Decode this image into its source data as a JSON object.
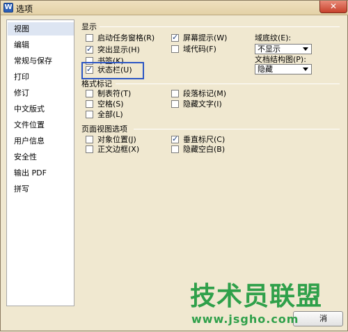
{
  "window": {
    "title": "选项",
    "app_icon": "W",
    "close_label": "✕"
  },
  "sidebar": {
    "items": [
      {
        "label": "视图",
        "selected": true
      },
      {
        "label": "编辑"
      },
      {
        "label": "常规与保存"
      },
      {
        "label": "打印"
      },
      {
        "label": "修订"
      },
      {
        "label": "中文版式"
      },
      {
        "label": "文件位置"
      },
      {
        "label": "用户信息"
      },
      {
        "label": "安全性"
      },
      {
        "label": "输出 PDF"
      },
      {
        "label": "拼写"
      }
    ]
  },
  "display": {
    "heading": "显示",
    "startup_task_pane": {
      "label": "启动任务窗格(R)",
      "checked": false
    },
    "highlight": {
      "label": "突出显示(H)",
      "checked": true
    },
    "bookmarks": {
      "label": "书签(K)",
      "checked": false
    },
    "status_bar": {
      "label": "状态栏(U)",
      "checked": true
    },
    "screen_tips": {
      "label": "屏幕提示(W)",
      "checked": true
    },
    "field_codes": {
      "label": "域代码(F)",
      "checked": false
    },
    "field_shading_label": "域底纹(E):",
    "field_shading_value": "不显示",
    "doc_map_label": "文档结构图(P):",
    "doc_map_value": "隐藏"
  },
  "format_marks": {
    "heading": "格式标记",
    "tabs": {
      "label": "制表符(T)",
      "checked": false
    },
    "spaces": {
      "label": "空格(S)",
      "checked": false
    },
    "all": {
      "label": "全部(L)",
      "checked": false
    },
    "paragraph_marks": {
      "label": "段落标记(M)",
      "checked": false
    },
    "hidden_text": {
      "label": "隐藏文字(I)",
      "checked": false
    }
  },
  "page_view": {
    "heading": "页面视图选项",
    "object_anchors": {
      "label": "对象位置(J)",
      "checked": false
    },
    "text_boundaries": {
      "label": "正文边框(X)",
      "checked": false
    },
    "vertical_ruler": {
      "label": "垂直标尺(C)",
      "checked": true
    },
    "hide_white_space": {
      "label": "隐藏空白(B)",
      "checked": false
    }
  },
  "footer": {
    "cancel_label": "消"
  },
  "watermark": {
    "main": "技术员联盟",
    "sub": "www.jsgho.com"
  }
}
